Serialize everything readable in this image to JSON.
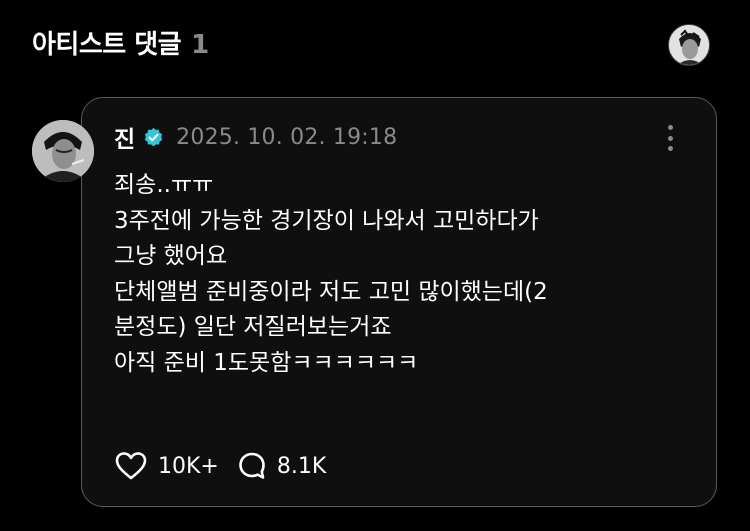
{
  "header": {
    "title": "아티스트 댓글",
    "count": "1"
  },
  "comment": {
    "author": "진",
    "timestamp": "2025. 10. 02. 19:18",
    "lines": [
      "죄송..ㅠㅠ",
      "3주전에 가능한 경기장이 나와서 고민하다가",
      "그냥 했어요",
      "단체앨범 준비중이라 저도 고민 많이했는데(2",
      "분정도) 일단 저질러보는거죠",
      "아직 준비 1도못함ㅋㅋㅋㅋㅋㅋ"
    ],
    "likes": "10K+",
    "replies": "8.1K"
  },
  "colors": {
    "background": "#000000",
    "card_border": "#5a5a5a",
    "muted": "#8a8a8a",
    "verified": "#34c6d6"
  },
  "icons": {
    "profile": "avatar",
    "verified": "verified-badge-icon",
    "more": "more-vertical-icon",
    "like": "heart-outline-icon",
    "reply": "speech-bubble-icon"
  }
}
